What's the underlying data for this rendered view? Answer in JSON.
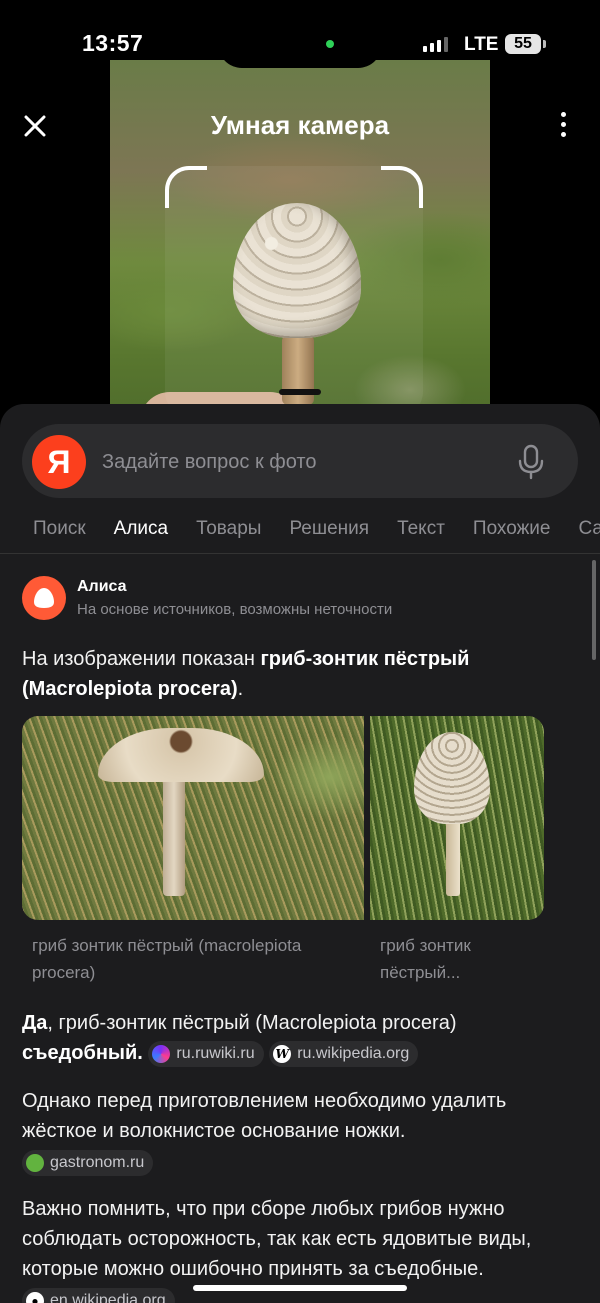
{
  "status_bar": {
    "time": "13:57",
    "network": "LTE",
    "battery": "55"
  },
  "topbar": {
    "title": "Умная камера"
  },
  "search": {
    "logo_letter": "Я",
    "placeholder": "Задайте вопрос к фото"
  },
  "tabs": [
    "Поиск",
    "Алиса",
    "Товары",
    "Решения",
    "Текст",
    "Похожие",
    "Са"
  ],
  "active_tab": "Алиса",
  "alice": {
    "name": "Алиса",
    "subtitle": "На основе источников, возможны неточности"
  },
  "answer": {
    "intro_pre": "На изображении показан ",
    "intro_bold": "гриб-зонтик пёстрый (Macrolepiota procera)",
    "intro_post": ".",
    "images": [
      {
        "caption": "гриб зонтик пёстрый (macrolepiota procera)"
      },
      {
        "caption": "гриб зонтик пёстрый..."
      }
    ],
    "edible_yes": "Да",
    "edible_mid": ", гриб-зонтик пёстрый (Macrolepiota procera) ",
    "edible_bold": "съедобный.",
    "edible_sources": [
      "ru.ruwiki.ru",
      "ru.wikipedia.org"
    ],
    "prep_text": "Однако перед приготовлением необходимо удалить жёсткое и волокнистое основание ножки.",
    "prep_source": "gastronom.ru",
    "caution_text": "Важно помнить, что при сборе любых грибов нужно соблюдать осторожность, так как есть ядовитые виды, которые можно ошибочно принять за съедобные.",
    "caution_source": "en.wikipedia.org"
  },
  "colors": {
    "yandex_red": "#fc3f1d",
    "alice_orange": "#ff5a36",
    "sheet_bg": "#1c1c1e",
    "accent_green": "#2ed158"
  }
}
